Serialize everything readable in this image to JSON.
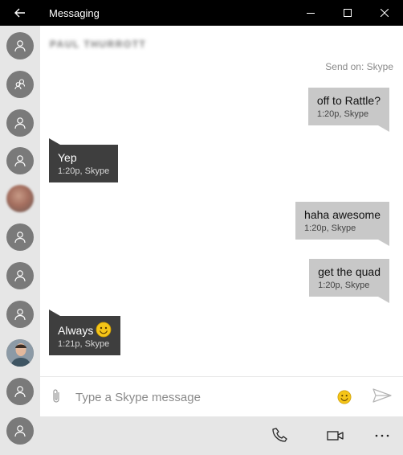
{
  "window": {
    "title": "Messaging"
  },
  "conversation": {
    "contact_name": "PAUL THURROTT",
    "send_on": "Send on: Skype"
  },
  "messages": [
    {
      "direction": "out",
      "text": "off to Rattle?",
      "meta": "1:20p, Skype"
    },
    {
      "direction": "in",
      "text": "Yep",
      "meta": "1:20p, Skype"
    },
    {
      "direction": "out",
      "text": "haha awesome",
      "meta": "1:20p, Skype"
    },
    {
      "direction": "out",
      "text": "get the quad",
      "meta": "1:20p, Skype"
    },
    {
      "direction": "in",
      "text": "Always",
      "meta": "1:21p, Skype",
      "emoji": "smiley-face"
    }
  ],
  "composer": {
    "placeholder": "Type a Skype message"
  },
  "icons": {
    "back": "back-arrow-icon",
    "minimize": "minimize-icon",
    "maximize": "maximize-icon",
    "close": "close-icon",
    "attach": "paperclip-icon",
    "emoji": "smiley-icon",
    "send": "send-icon",
    "call": "phone-icon",
    "video": "video-camera-icon",
    "more": "more-dots-icon"
  },
  "colors": {
    "titlebar": "#000000",
    "sidebar": "#e6e6e6",
    "bubble_out": "#c8c8c8",
    "bubble_in": "#3e3e3e",
    "emoji": "#f5c518"
  }
}
